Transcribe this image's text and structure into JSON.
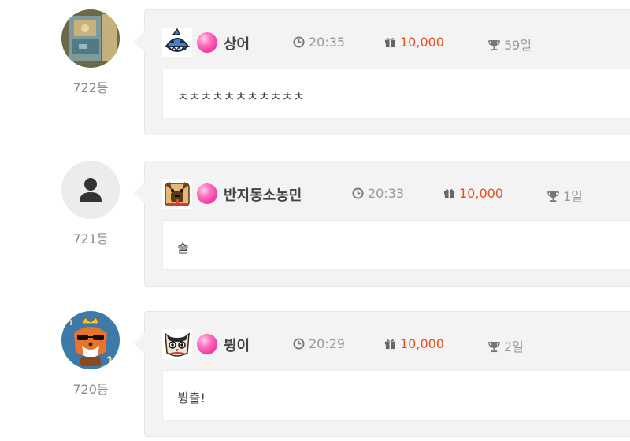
{
  "comments": [
    {
      "avatar": "photo-avatar",
      "rank": "722등",
      "level_icon": "shark-icon",
      "nickname": "상어",
      "time": "20:35",
      "gift": "10,000",
      "trophy": "59일",
      "message": "ㅊㅊㅊㅊㅊㅊㅊㅊㅊㅊㅊ"
    },
    {
      "avatar": "default-user-avatar",
      "rank": "721등",
      "level_icon": "pug-icon",
      "nickname": "반지동소농민",
      "time": "20:33",
      "gift": "10,000",
      "trophy": "1일",
      "message": "출"
    },
    {
      "avatar": "fox-with-crown-avatar",
      "rank": "720등",
      "level_icon": "owl-icon",
      "nickname": "뷩이",
      "time": "20:29",
      "gift": "10,000",
      "trophy": "2일",
      "message": "뷩출!"
    }
  ],
  "colors": {
    "gift": "#e8501e",
    "candy": "#ff6fbf",
    "bubble_bg": "#f3f3f3"
  }
}
